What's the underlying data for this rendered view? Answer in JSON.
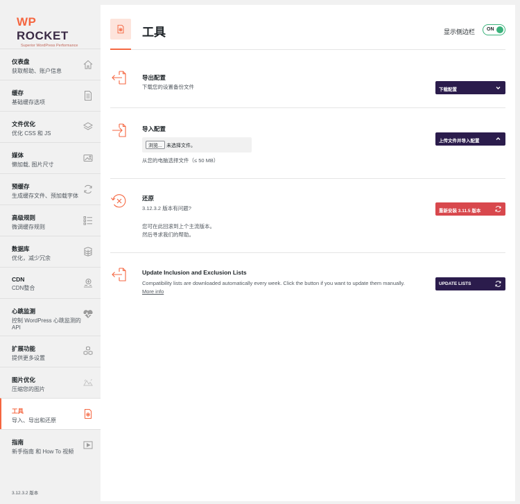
{
  "brand": {
    "name_wp": "WP",
    "name_rocket": "ROCKET",
    "tagline": "Superior WordPress Performance"
  },
  "nav": [
    {
      "title": "仪表盘",
      "sub": "获取帮助、账户信息",
      "icon": "home-icon"
    },
    {
      "title": "缓存",
      "sub": "基础缓存选项",
      "icon": "file-icon"
    },
    {
      "title": "文件优化",
      "sub": "优化 CSS 和 JS",
      "icon": "layers-icon"
    },
    {
      "title": "媒体",
      "sub": "懒加载, 图片尺寸",
      "icon": "image-icon"
    },
    {
      "title": "预缓存",
      "sub": "生成缓存文件、预加载字体",
      "icon": "refresh-icon"
    },
    {
      "title": "高级规则",
      "sub": "微调缓存规则",
      "icon": "list-icon"
    },
    {
      "title": "数据库",
      "sub": "优化，减少冗余",
      "icon": "database-icon"
    },
    {
      "title": "CDN",
      "sub": "CDN整合",
      "icon": "cdn-icon"
    },
    {
      "title": "心跳监测",
      "sub": "控制 WordPress 心跳监测的 API",
      "icon": "heartbeat-icon"
    },
    {
      "title": "扩展功能",
      "sub": "提供更多设置",
      "icon": "cubes-icon"
    },
    {
      "title": "图片优化",
      "sub": "压缩您的图片",
      "icon": "imagify-icon"
    },
    {
      "title": "工具",
      "sub": "导入、导出和还原",
      "icon": "tools-icon"
    },
    {
      "title": "指南",
      "sub": "新手指南 和 How To 视频",
      "icon": "video-icon"
    }
  ],
  "version_label": "3.12.3.2 版本",
  "header": {
    "title": "工具",
    "sidebar_toggle_label": "显示侧边栏",
    "toggle_state": "ON"
  },
  "export": {
    "title": "导出配置",
    "desc": "下载您的设置备份文件",
    "button": "下载配置"
  },
  "import": {
    "title": "导入配置",
    "browse": "浏览...",
    "no_file": "未选择文件。",
    "hint": "从您的电脑选择文件（≤ 50 MB）",
    "button": "上传文件并导入配置"
  },
  "rollback": {
    "title": "还原",
    "question": "3.12.3.2 版本有问题?",
    "line1": "您可在此回滚到上个主流版本。",
    "line2": "然后寻求我们的帮助。",
    "button": "重新安装 3.11.5 版本"
  },
  "update_lists": {
    "title": "Update Inclusion and Exclusion Lists",
    "desc": "Compatibility lists are downloaded automatically every week. Click the button if you want to update them manually.",
    "more_info": "More info",
    "button": "UPDATE LISTS"
  },
  "colors": {
    "accent": "#f56640",
    "primary_button": "#2b1c4c",
    "danger_button": "#d8484d",
    "toggle_on": "#3ab27b"
  }
}
